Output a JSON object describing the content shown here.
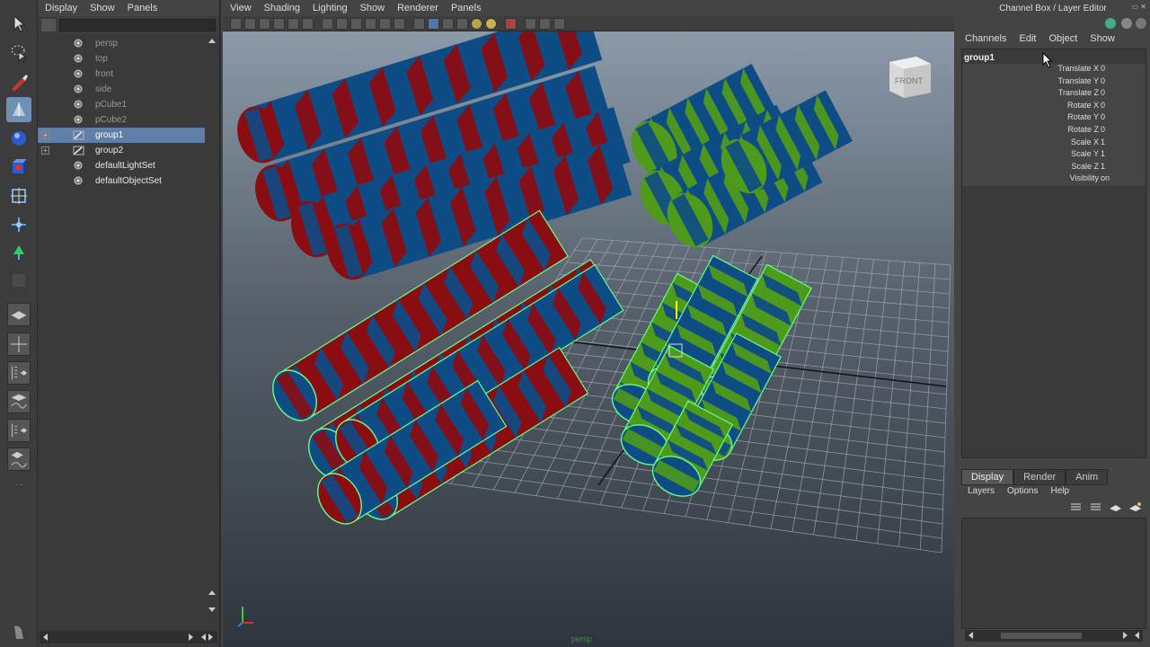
{
  "outliner": {
    "menu": [
      "Display",
      "Show",
      "Panels"
    ],
    "items": [
      {
        "label": "persp",
        "style": "dim",
        "expander": ""
      },
      {
        "label": "top",
        "style": "dim",
        "expander": ""
      },
      {
        "label": "front",
        "style": "dim",
        "expander": ""
      },
      {
        "label": "side",
        "style": "dim",
        "expander": ""
      },
      {
        "label": "pCube1",
        "style": "dim",
        "expander": ""
      },
      {
        "label": "pCube2",
        "style": "dim",
        "expander": ""
      },
      {
        "label": "group1",
        "style": "selected",
        "expander": "+"
      },
      {
        "label": "group2",
        "style": "bright",
        "expander": "+"
      },
      {
        "label": "defaultLightSet",
        "style": "bright",
        "expander": ""
      },
      {
        "label": "defaultObjectSet",
        "style": "bright",
        "expander": ""
      }
    ]
  },
  "viewport": {
    "menu": [
      "View",
      "Shading",
      "Lighting",
      "Show",
      "Renderer",
      "Panels"
    ],
    "viewcube_label": "FRONT",
    "camera_label": "persp"
  },
  "channelbox": {
    "title": "Channel Box / Layer Editor",
    "menu": [
      "Channels",
      "Edit",
      "Object",
      "Show"
    ],
    "object_name": "group1",
    "attributes": [
      {
        "name": "Translate X",
        "value": "0"
      },
      {
        "name": "Translate Y",
        "value": "0"
      },
      {
        "name": "Translate Z",
        "value": "0"
      },
      {
        "name": "Rotate X",
        "value": "0"
      },
      {
        "name": "Rotate Y",
        "value": "0"
      },
      {
        "name": "Rotate Z",
        "value": "0"
      },
      {
        "name": "Scale X",
        "value": "1"
      },
      {
        "name": "Scale Y",
        "value": "1"
      },
      {
        "name": "Scale Z",
        "value": "1"
      },
      {
        "name": "Visibility",
        "value": "on"
      }
    ]
  },
  "layer_editor": {
    "tabs": [
      "Display",
      "Render",
      "Anim"
    ],
    "active_tab": "Display",
    "menu": [
      "Layers",
      "Options",
      "Help"
    ]
  },
  "colors": {
    "red": "#8a0d12",
    "blue": "#0e4c86",
    "green": "#4e9a1a",
    "highlight": "#66ff88",
    "selection": "#5f7fa8"
  }
}
